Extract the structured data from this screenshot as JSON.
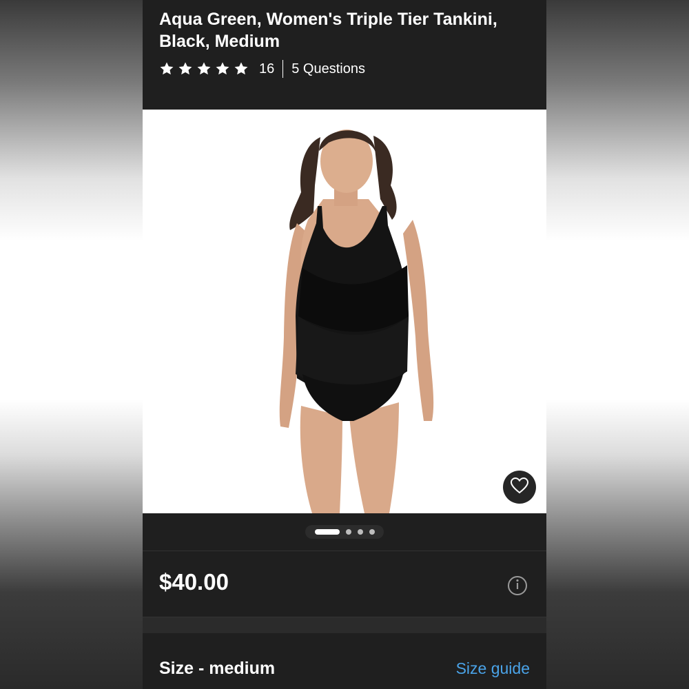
{
  "product": {
    "title": "Aqua Green, Women's Triple Tier Tankini, Black, Medium",
    "rating_stars": 5,
    "review_count": "16",
    "questions_label": "5 Questions"
  },
  "gallery": {
    "image_count": 4,
    "active_index": 0,
    "image_description_icon": "product-photo"
  },
  "pricing": {
    "price": "$40.00"
  },
  "size": {
    "label": "Size - medium",
    "guide_link": "Size guide"
  },
  "colors": {
    "background": "#1f1f1f",
    "text": "#ffffff",
    "link": "#4aa3e8"
  }
}
